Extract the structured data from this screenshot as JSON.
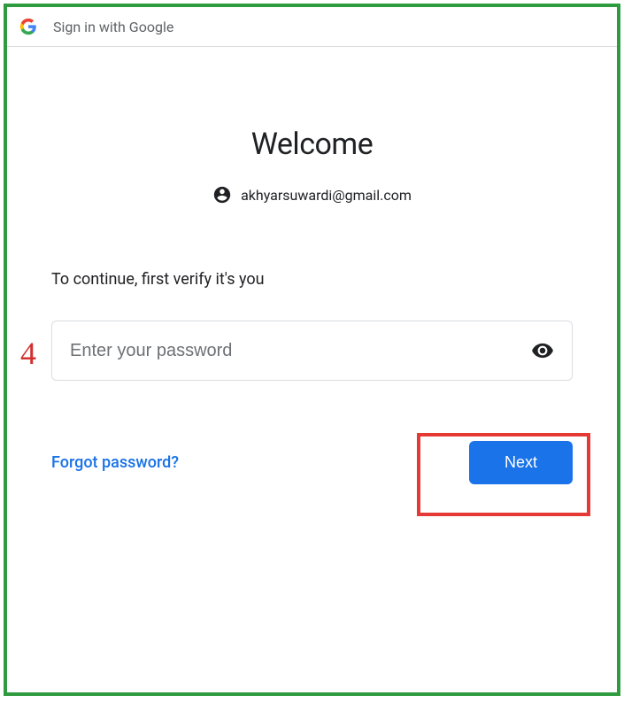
{
  "header": {
    "title": "Sign in with Google"
  },
  "main": {
    "welcome": "Welcome",
    "email": "akhyarsuwardi@gmail.com",
    "verifyPrompt": "To continue, first verify it's you",
    "passwordPlaceholder": "Enter your password",
    "forgotLink": "Forgot password?",
    "nextButton": "Next"
  },
  "annotation": {
    "step": "4"
  }
}
